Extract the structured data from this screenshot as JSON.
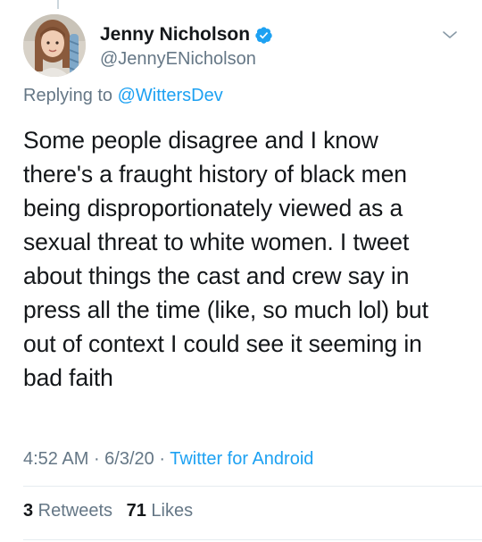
{
  "tweet": {
    "author": {
      "display_name": "Jenny Nicholson",
      "handle": "@JennyENicholson",
      "verified": true
    },
    "reply": {
      "prefix": "Replying to ",
      "handle": "@WittersDev"
    },
    "text_lines": [
      "Some people disagree and I know",
      "there's a fraught history of black men",
      "being disproportionately viewed as a",
      "sexual threat to white women. I tweet",
      "about things the cast and crew say in",
      "press all the time (like, so much lol) but",
      "out of context I could see it seeming in",
      "bad faith"
    ],
    "meta": {
      "time": "4:52 AM",
      "separator": " · ",
      "date": "6/3/20",
      "source": "Twitter for Android"
    },
    "stats": {
      "retweets_count": "3",
      "retweets_label": " Retweets",
      "likes_count": "71",
      "likes_label": " Likes"
    }
  },
  "icons": {
    "verified": "verified-badge-icon",
    "menu": "chevron-down-icon"
  },
  "colors": {
    "accent": "#1da1f2",
    "text": "#14171a",
    "secondary": "#657786",
    "divider": "#e6ecf0"
  }
}
